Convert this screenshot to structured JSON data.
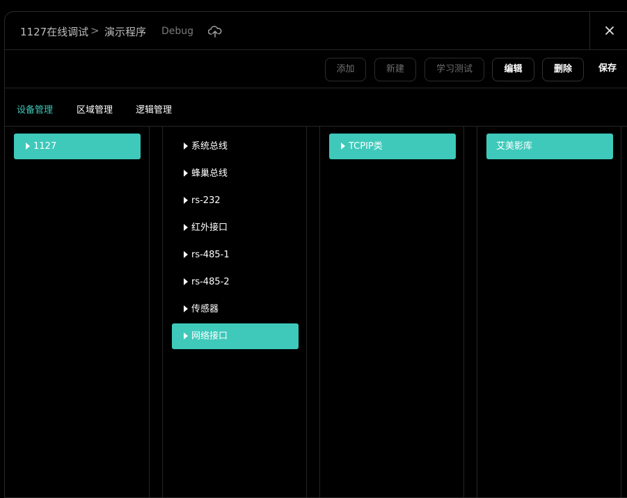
{
  "header": {
    "breadcrumb_1": "1127在线调试",
    "separator": ">",
    "breadcrumb_2": "演示程序",
    "mode": "Debug",
    "sync_icon": "cloud-sync-icon",
    "close_icon": "close-icon"
  },
  "toolbar": {
    "add": "添加",
    "new": "新建",
    "learn_test": "学习测试",
    "edit": "编辑",
    "delete": "删除",
    "save": "保存"
  },
  "tabs": [
    "设备管理",
    "区域管理",
    "逻辑管理"
  ],
  "columns": {
    "devices": [
      "1127"
    ],
    "interfaces": [
      "系统总线",
      "蜂巢总线",
      "rs-232",
      "红外接口",
      "rs-485-1",
      "rs-485-2",
      "传感器",
      "网络接口"
    ],
    "categories": [
      "TCPIP类"
    ],
    "models": [
      "艾美影库"
    ]
  },
  "colors": {
    "accent": "#3ec9bb",
    "background": "#000000",
    "border": "#262626"
  }
}
